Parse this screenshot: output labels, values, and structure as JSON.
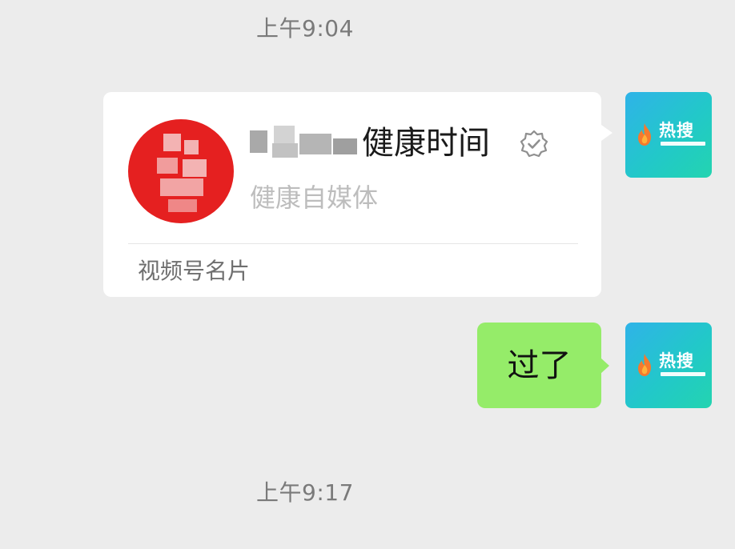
{
  "messages": [
    {
      "kind": "timestamp",
      "text": "上午9:04"
    },
    {
      "kind": "card",
      "sender": "self",
      "card": {
        "title": "健康时间",
        "subtitle": "健康自媒体",
        "footer": "视频号名片",
        "verified_icon": "verified-badge-icon"
      }
    },
    {
      "kind": "text",
      "sender": "self",
      "text": "过了"
    },
    {
      "kind": "timestamp",
      "text": "上午9:17"
    }
  ],
  "self_avatar": {
    "brand_text": "热搜",
    "icon": "flame-icon",
    "gradient": [
      "#2fb3e8",
      "#23d4b0"
    ]
  },
  "colors": {
    "background": "#ececec",
    "bubble_self": "#95ec69",
    "card_bg": "#ffffff",
    "card_avatar": "#e52020"
  }
}
